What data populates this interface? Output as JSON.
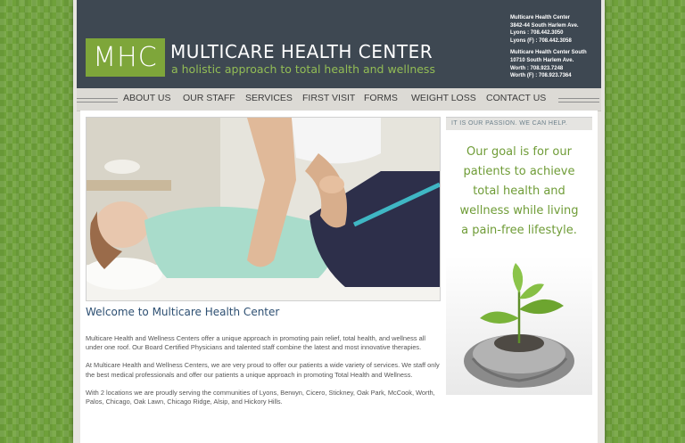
{
  "header": {
    "logo_text": "MHC",
    "site_name": "MULTICARE HEALTH CENTER",
    "tagline": "a holistic approach to total health and wellness",
    "locations": [
      {
        "name": "Multicare Health Center",
        "address": "3842-44 South Harlem Ave.",
        "phone": "Lyons : 708.442.3050",
        "fax": "Lyons (F) : 708.442.3058"
      },
      {
        "name": "Multicare Health Center South",
        "address": "10710 South Harlem Ave.",
        "phone": "Worth : 708.923.7248",
        "fax": "Worth (F) : 708.923.7364"
      }
    ]
  },
  "nav": {
    "items": [
      "ABOUT US",
      "OUR STAFF",
      "SERVICES",
      "FIRST VISIT",
      "FORMS",
      "WEIGHT LOSS",
      "CONTACT US"
    ]
  },
  "main": {
    "welcome_title": "Welcome to Multicare Health Center",
    "paragraphs": [
      "Multicare Health and Wellness Centers offer a unique approach in promoting pain relief, total health, and wellness all under one roof. Our Board Certified Physicians and talented staff combine the latest and most innovative therapies.",
      "At Multicare Health and Wellness Centers, we are very proud to offer our patients a wide variety of services. We staff only the best medical professionals and offer our patients a unique approach in promoting Total Health and Wellness.",
      "With 2 locations we are proudly serving the communities of Lyons, Berwyn, Cicero, Stickney, Oak Park, McCook, Worth, Palos, Chicago, Oak Lawn, Chicago Ridge, Alsip, and Hickory Hills."
    ]
  },
  "sidebar": {
    "passion": "IT IS OUR PASSION. WE CAN HELP.",
    "goal_lines": [
      "Our goal is for our",
      "patients to achieve",
      "total health and",
      "wellness while living",
      "a pain-free lifestyle."
    ]
  },
  "colors": {
    "accent_green": "#7ea63a",
    "header_slate": "#3e4852",
    "link_blue": "#2d4f72"
  }
}
